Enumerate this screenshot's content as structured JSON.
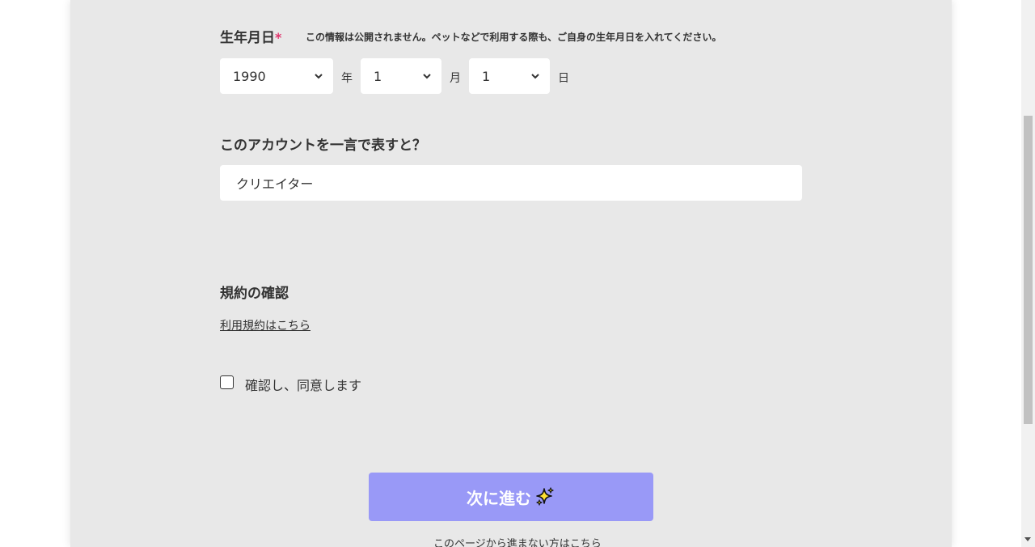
{
  "birthdate": {
    "label": "生年月日",
    "required_mark": "*",
    "hint": "この情報は公開されません。ペットなどで利用する際も、ご自身の生年月日を入れてください。",
    "year": {
      "value": "1990",
      "unit": "年"
    },
    "month": {
      "value": "1",
      "unit": "月"
    },
    "day": {
      "value": "1",
      "unit": "日"
    }
  },
  "account_description": {
    "label": "このアカウントを一言で表すと？",
    "value": "クリエイター"
  },
  "terms": {
    "label": "規約の確認",
    "link_text": "利用規約はこちら",
    "agree_label": "確認し、同意します",
    "agree_checked": false
  },
  "next_button": {
    "label": "次に進む",
    "icon": "sparkles-icon",
    "color": "#9999f7"
  },
  "skip_link": "このページから進まない方はこちら",
  "colors": {
    "panel_background": "#e8e8e8",
    "required": "#e0356d",
    "text": "#333333"
  }
}
